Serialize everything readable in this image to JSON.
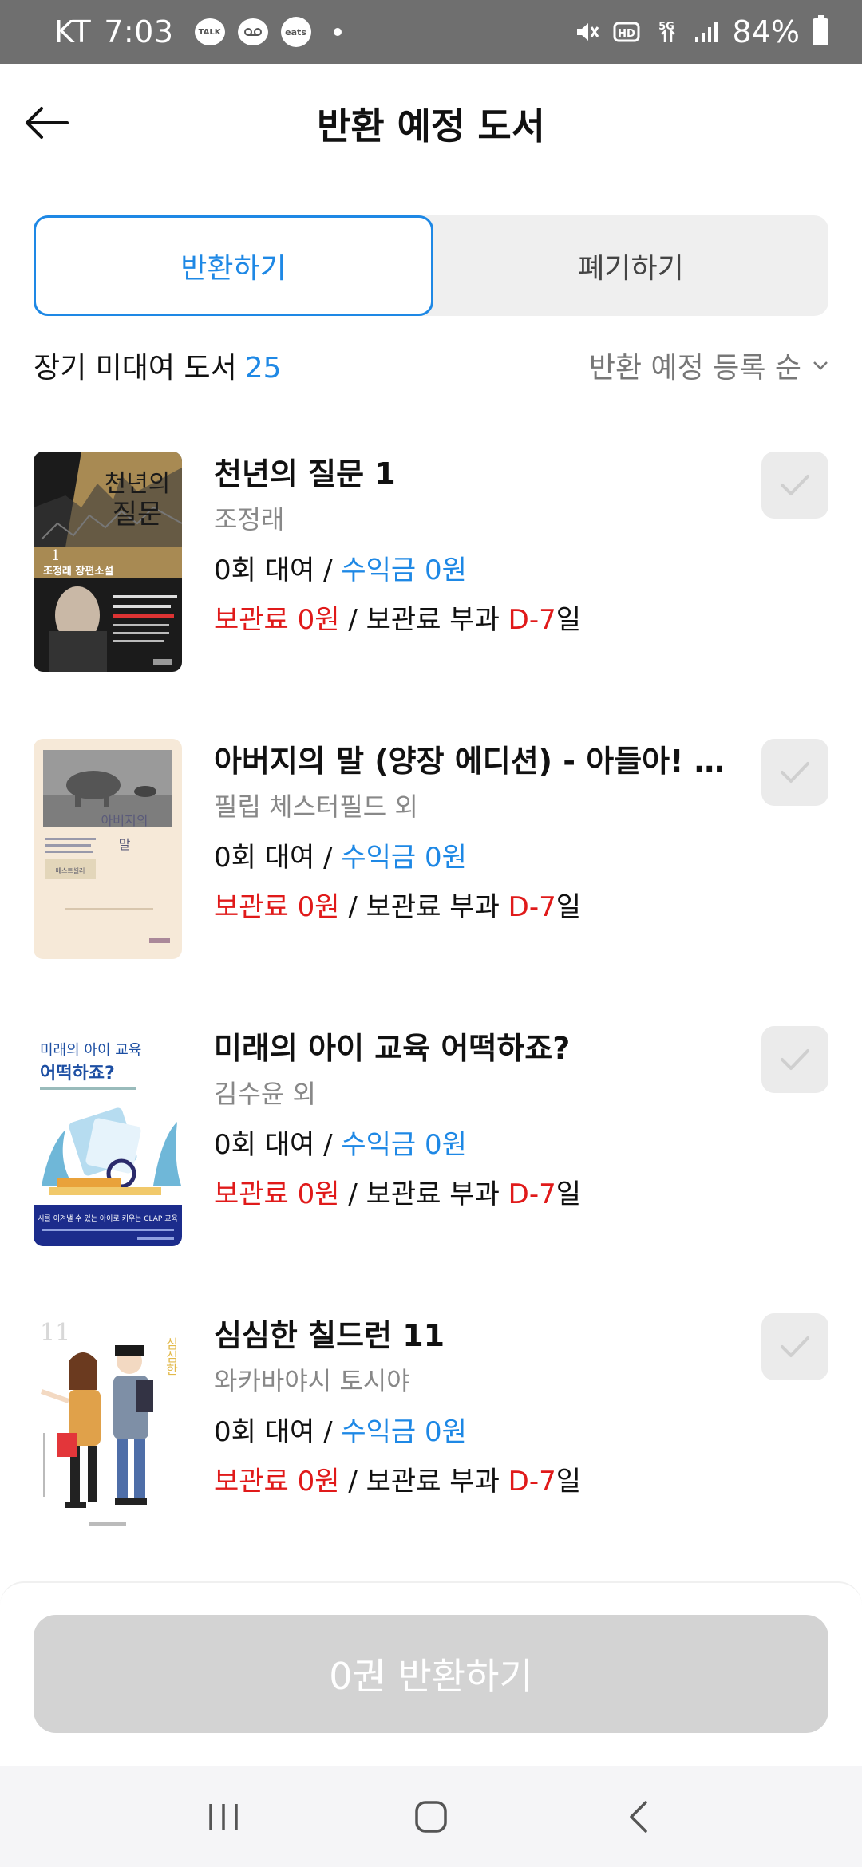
{
  "status_bar": {
    "carrier": "KT",
    "time": "7:03",
    "talk_label": "TALK",
    "eats_label": "eats",
    "battery": "84%"
  },
  "header": {
    "title": "반환 예정 도서"
  },
  "tabs": [
    {
      "label": "반환하기",
      "active": true
    },
    {
      "label": "폐기하기",
      "active": false
    }
  ],
  "list": {
    "title": "장기 미대여 도서",
    "count": "25",
    "sort_label": "반환 예정 등록 순"
  },
  "books": [
    {
      "title": "천년의 질문 1",
      "author": "조정래",
      "rental_count": "0회 대여",
      "earnings": "수익금 0원",
      "storage_fee": "보관료 0원",
      "fee_due_prefix": "보관료 부과",
      "fee_due_d": "D-7",
      "fee_due_suffix": "일"
    },
    {
      "title": "아버지의 말 (양장 에디션) - 아들아! 네 ...",
      "author": "필립 체스터필드 외",
      "rental_count": "0회 대여",
      "earnings": "수익금 0원",
      "storage_fee": "보관료 0원",
      "fee_due_prefix": "보관료 부과",
      "fee_due_d": "D-7",
      "fee_due_suffix": "일"
    },
    {
      "title": "미래의 아이 교육 어떡하죠?",
      "author": "김수윤 외",
      "rental_count": "0회 대여",
      "earnings": "수익금 0원",
      "storage_fee": "보관료 0원",
      "fee_due_prefix": "보관료 부과",
      "fee_due_d": "D-7",
      "fee_due_suffix": "일"
    },
    {
      "title": "심심한 칠드런 11",
      "author": "와카바야시 토시야",
      "rental_count": "0회 대여",
      "earnings": "수익금 0원",
      "storage_fee": "보관료 0원",
      "fee_due_prefix": "보관료 부과",
      "fee_due_d": "D-7",
      "fee_due_suffix": "일"
    }
  ],
  "covers": [
    {
      "line1": "천년의",
      "line2": "질문",
      "line3": "1",
      "line4": "조정래 장편소설"
    },
    {
      "line1": "아버지의",
      "line2": "말",
      "line3": "베스트셀러"
    },
    {
      "line1": "미래의 아이 교육",
      "line2": "어떡하죠?",
      "line3": "시를 이겨낼 수 있는 아이로 키우는 CLAP 교육"
    },
    {
      "line1": "11",
      "line2": "심심한"
    }
  ],
  "bottom": {
    "return_button": "0권 반환하기"
  },
  "colors": {
    "accent": "#1e88e5",
    "danger": "#e01a1a",
    "disabled": "#d3d3d3"
  }
}
